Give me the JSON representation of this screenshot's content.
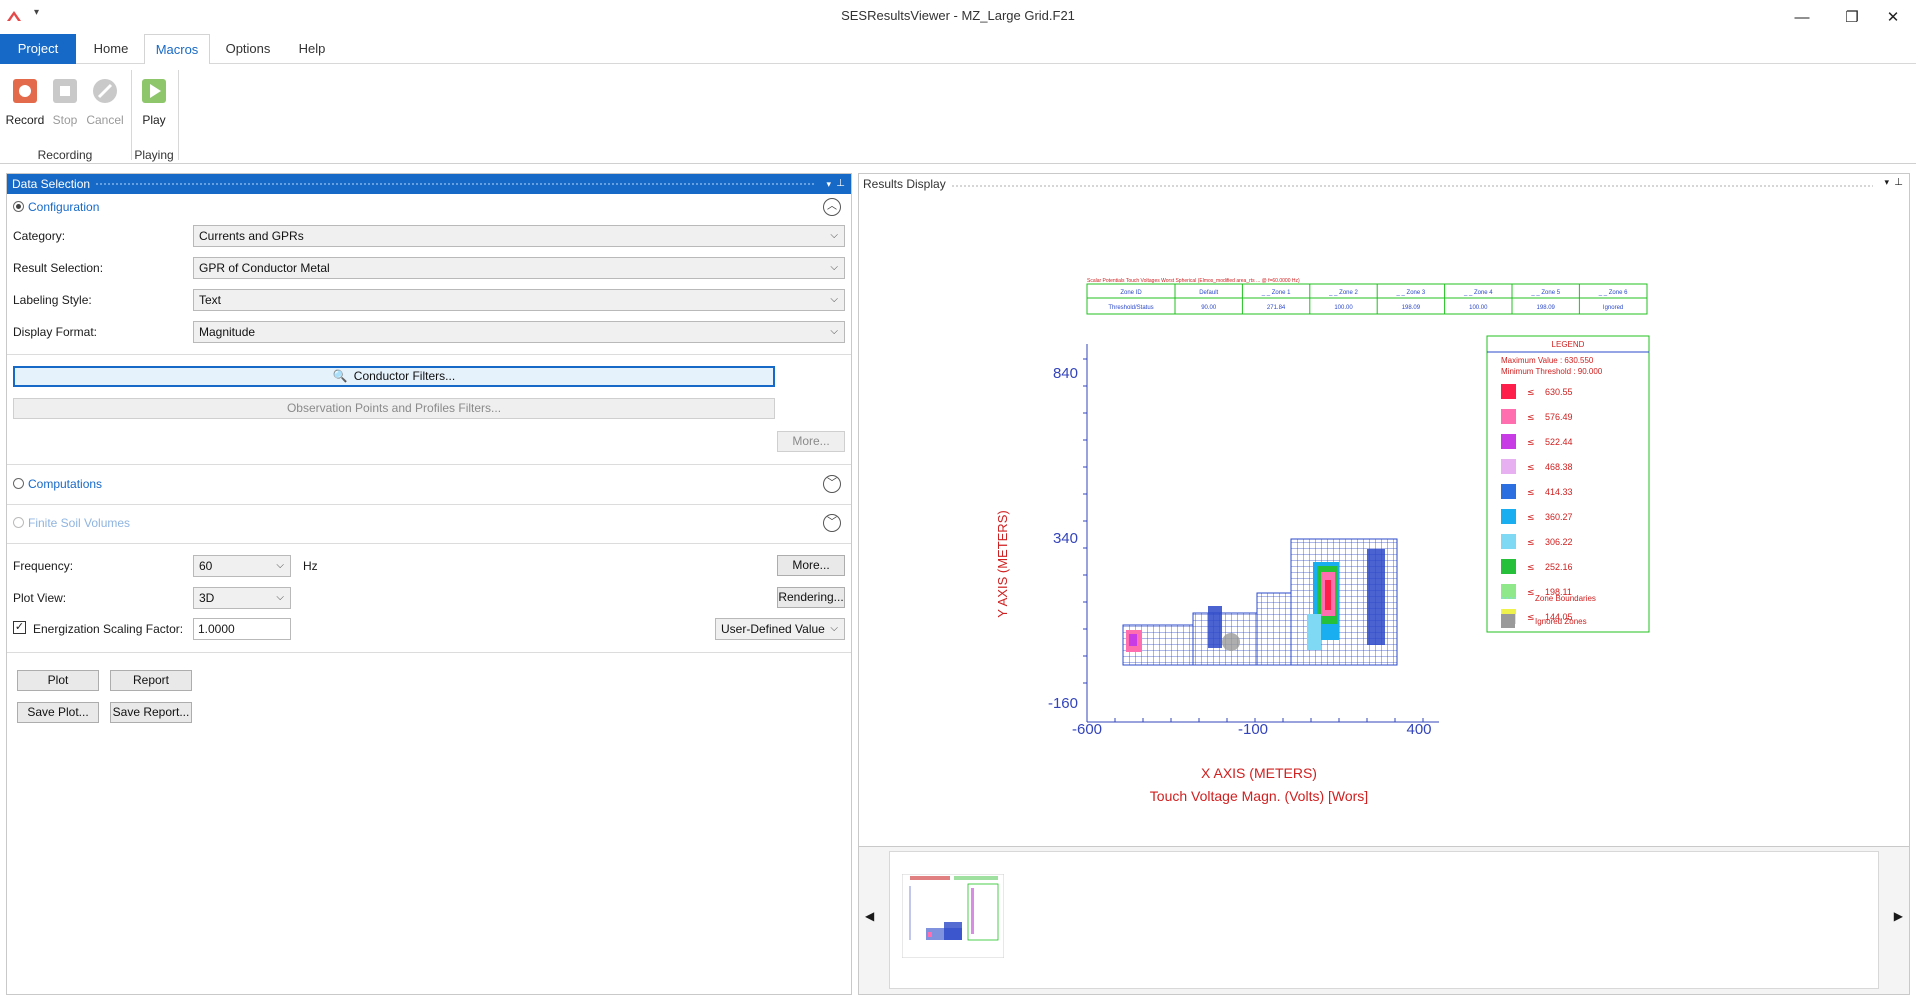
{
  "window": {
    "title": "SESResultsViewer - MZ_Large Grid.F21",
    "controls": [
      "—",
      "❐",
      "✕"
    ]
  },
  "tabs": [
    "Project",
    "Home",
    "Macros",
    "Options",
    "Help"
  ],
  "active_tab": "Macros",
  "ribbon": {
    "buttons": [
      {
        "label": "Record",
        "icon": "record-icon"
      },
      {
        "label": "Stop",
        "icon": "stop-icon"
      },
      {
        "label": "Cancel",
        "icon": "cancel-icon"
      },
      {
        "label": "Play",
        "icon": "play-icon"
      }
    ],
    "groups": [
      "Recording",
      "Playing"
    ]
  },
  "data_selection": {
    "title": "Data Selection",
    "configuration": "Configuration",
    "fields": [
      {
        "label": "Category:",
        "value": "Currents and GPRs"
      },
      {
        "label": "Result Selection:",
        "value": "GPR of Conductor Metal"
      },
      {
        "label": "Labeling Style:",
        "value": "Text"
      },
      {
        "label": "Display Format:",
        "value": "Magnitude"
      }
    ],
    "conductor_filters": "Conductor Filters...",
    "observation_filters": "Observation Points and Profiles Filters...",
    "more": "More...",
    "computations": "Computations",
    "finite_soil": "Finite Soil Volumes",
    "frequency_label": "Frequency:",
    "frequency_value": "60",
    "frequency_unit": "Hz",
    "plot_view_label": "Plot View:",
    "plot_view_value": "3D",
    "rendering": "Rendering...",
    "scaling_label": "Energization Scaling Factor:",
    "scaling_value": "1.0000",
    "scaling_mode": "User-Defined Value",
    "plot": "Plot",
    "report": "Report",
    "save_plot": "Save Plot...",
    "save_report": "Save Report..."
  },
  "results_display": {
    "title": "Results Display",
    "header_text": "Scalar Potentials Touch Voltages Worst Spherical (Elmos_modified area_rts ... @ f=60.0000 Hz)",
    "zone_table": {
      "headers": [
        "Zone ID",
        "Default",
        "_ _ Zone 1",
        "_ _ Zone 2",
        "_ _ Zone 3",
        "_ _ Zone 4",
        "_ _ Zone 5",
        "_ _ Zone 6"
      ],
      "row": [
        "Threshold/Status",
        "90.00",
        "271.84",
        "100.00",
        "198.09",
        "100.00",
        "198.09",
        "Ignored"
      ]
    },
    "y_ticks": [
      "840",
      "340",
      "-160"
    ],
    "x_ticks": [
      "-600",
      "-100",
      "400"
    ],
    "y_axis_label": "Y AXIS  (METERS)",
    "x_axis_label": "X AXIS  (METERS)",
    "plot_title": "Touch Voltage Magn. (Volts) [Wors]",
    "legend": {
      "title": "LEGEND",
      "max_label": "Maximum Value :   630.550",
      "min_label": "Minimum Threshold :    90.000",
      "items": [
        {
          "color": "#ff1f4b",
          "value": "630.55"
        },
        {
          "color": "#ff6fb0",
          "value": "576.49"
        },
        {
          "color": "#c83ce6",
          "value": "522.44"
        },
        {
          "color": "#e7b0f0",
          "value": "468.38"
        },
        {
          "color": "#2b6fe0",
          "value": "414.33"
        },
        {
          "color": "#18aef0",
          "value": "360.27"
        },
        {
          "color": "#7fd8f4",
          "value": "306.22"
        },
        {
          "color": "#27c03a",
          "value": "252.16"
        },
        {
          "color": "#8fe88a",
          "value": "198.11"
        },
        {
          "color": "#eef24a",
          "value": "144.05"
        }
      ],
      "zone_boundaries": "Zone Boundaries",
      "ignored_zones": "Ignored Zones"
    }
  }
}
